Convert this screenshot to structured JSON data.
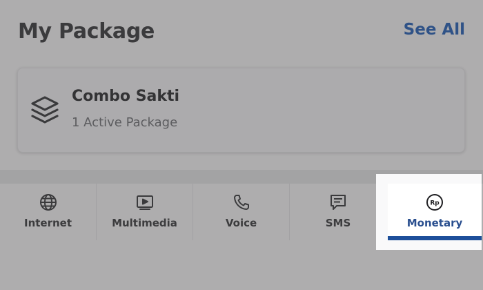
{
  "header": {
    "title": "My Package",
    "see_all": "See All"
  },
  "package_card": {
    "icon": "layers-icon",
    "name": "Combo Sakti",
    "subtitle": "1 Active Package"
  },
  "tabs": [
    {
      "label": "Internet",
      "icon": "globe-icon"
    },
    {
      "label": "Multimedia",
      "icon": "play-video-icon"
    },
    {
      "label": "Voice",
      "icon": "phone-icon"
    },
    {
      "label": "SMS",
      "icon": "message-icon"
    },
    {
      "label": "Monetary",
      "icon": "rupiah-coin-icon",
      "active": true
    }
  ],
  "colors": {
    "accent": "#1d4f9a",
    "link": "#2f5287",
    "overlay_background": "#aeadae"
  }
}
